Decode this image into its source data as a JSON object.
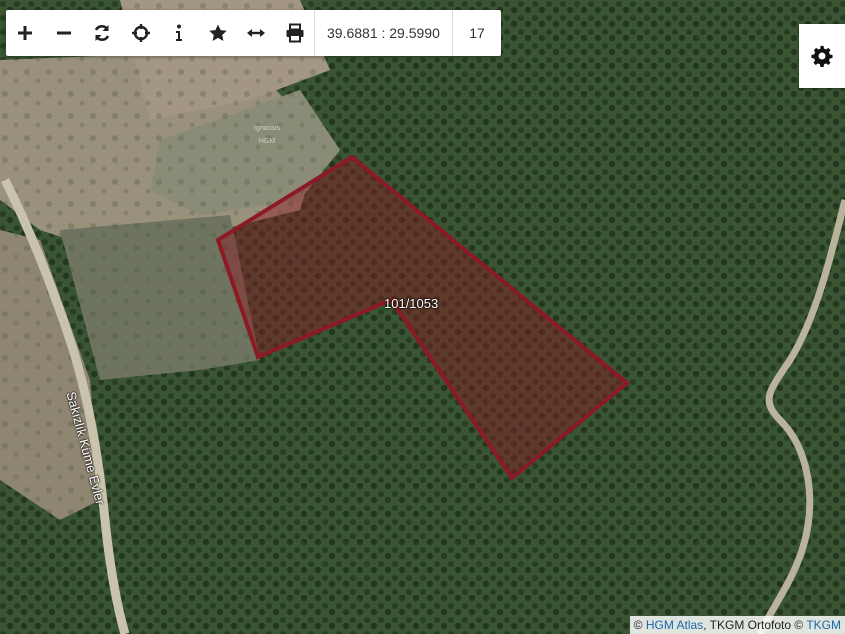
{
  "toolbar": {
    "tools": [
      {
        "name": "zoom-in-button",
        "icon": "plus-icon"
      },
      {
        "name": "zoom-out-button",
        "icon": "minus-icon"
      },
      {
        "name": "refresh-button",
        "icon": "refresh-icon"
      },
      {
        "name": "locate-button",
        "icon": "crosshair-icon"
      },
      {
        "name": "info-button",
        "icon": "info-icon"
      },
      {
        "name": "favorite-button",
        "icon": "star-icon"
      },
      {
        "name": "measure-button",
        "icon": "arrows-horizontal-icon"
      },
      {
        "name": "print-button",
        "icon": "printer-icon"
      }
    ],
    "coordinates": "39.6881 : 29.5990",
    "zoom_level": "17"
  },
  "settings": {
    "icon": "gear-icon"
  },
  "map": {
    "parcel_label": "101/1053",
    "road_label": "Sakızlık Küme Evler",
    "faint_label_line1": "Ignacius",
    "faint_label_line2": "HGM",
    "parcel_color": "#8b1a24"
  },
  "attribution": {
    "prefix": "© ",
    "link1": "HGM Atlas",
    "middle": ", TKGM Ortofoto © ",
    "link2": "TKGM"
  }
}
